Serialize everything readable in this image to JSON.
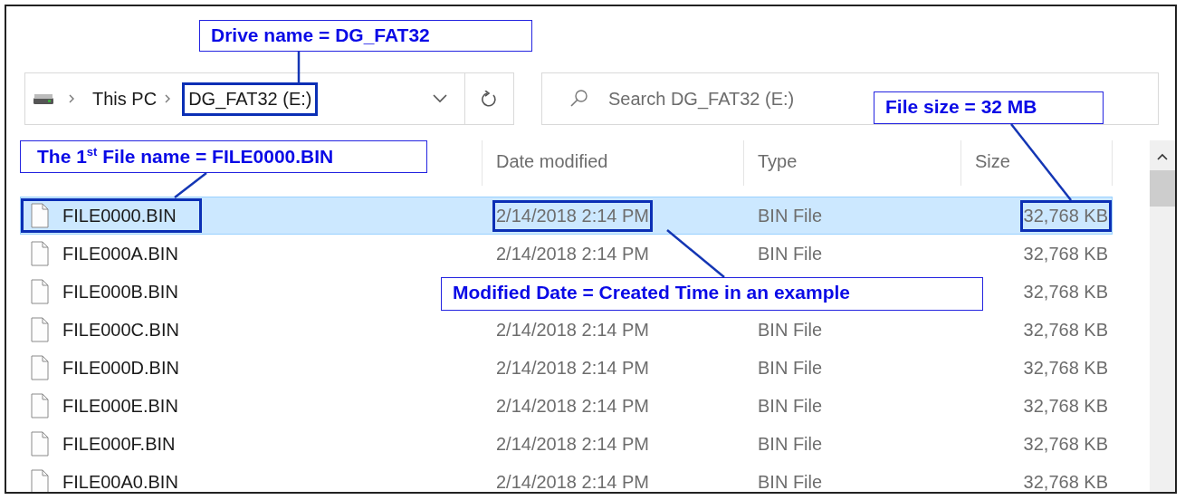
{
  "address_bar": {
    "crumbs": [
      {
        "label": "This PC",
        "annotated": false
      },
      {
        "label": "DG_FAT32 (E:)",
        "annotated": true
      }
    ]
  },
  "search": {
    "placeholder": "Search DG_FAT32 (E:)"
  },
  "columns": [
    {
      "label": "Date modified"
    },
    {
      "label": "Type"
    },
    {
      "label": "Size"
    }
  ],
  "rows": [
    {
      "name": "FILE0000.BIN",
      "date": "2/14/2018 2:14 PM",
      "type": "BIN File",
      "size": "32,768 KB",
      "selected": true,
      "annotated": true
    },
    {
      "name": "FILE000A.BIN",
      "date": "2/14/2018 2:14 PM",
      "type": "BIN File",
      "size": "32,768 KB",
      "selected": false,
      "annotated": false
    },
    {
      "name": "FILE000B.BIN",
      "size": "32,768 KB",
      "selected": false,
      "annotated": false
    },
    {
      "name": "FILE000C.BIN",
      "date": "2/14/2018 2:14 PM",
      "type": "BIN File",
      "size": "32,768 KB",
      "selected": false,
      "annotated": false
    },
    {
      "name": "FILE000D.BIN",
      "date": "2/14/2018 2:14 PM",
      "type": "BIN File",
      "size": "32,768 KB",
      "selected": false,
      "annotated": false
    },
    {
      "name": "FILE000E.BIN",
      "date": "2/14/2018 2:14 PM",
      "type": "BIN File",
      "size": "32,768 KB",
      "selected": false,
      "annotated": false
    },
    {
      "name": "FILE000F.BIN",
      "date": "2/14/2018 2:14 PM",
      "type": "BIN File",
      "size": "32,768 KB",
      "selected": false,
      "annotated": false
    },
    {
      "name": "FILE00A0.BIN",
      "date": "2/14/2018 2:14 PM",
      "type": "BIN File",
      "size": "32,768 KB",
      "selected": false,
      "annotated": false
    }
  ],
  "annotations": [
    {
      "text": "Drive name = DG_FAT32"
    },
    {
      "text": "The 1$^{st}$ File name = FILE0000.BIN"
    },
    {
      "text": "File size = 32 MB"
    },
    {
      "text": "Modified Date = Created Time in an example"
    }
  ]
}
